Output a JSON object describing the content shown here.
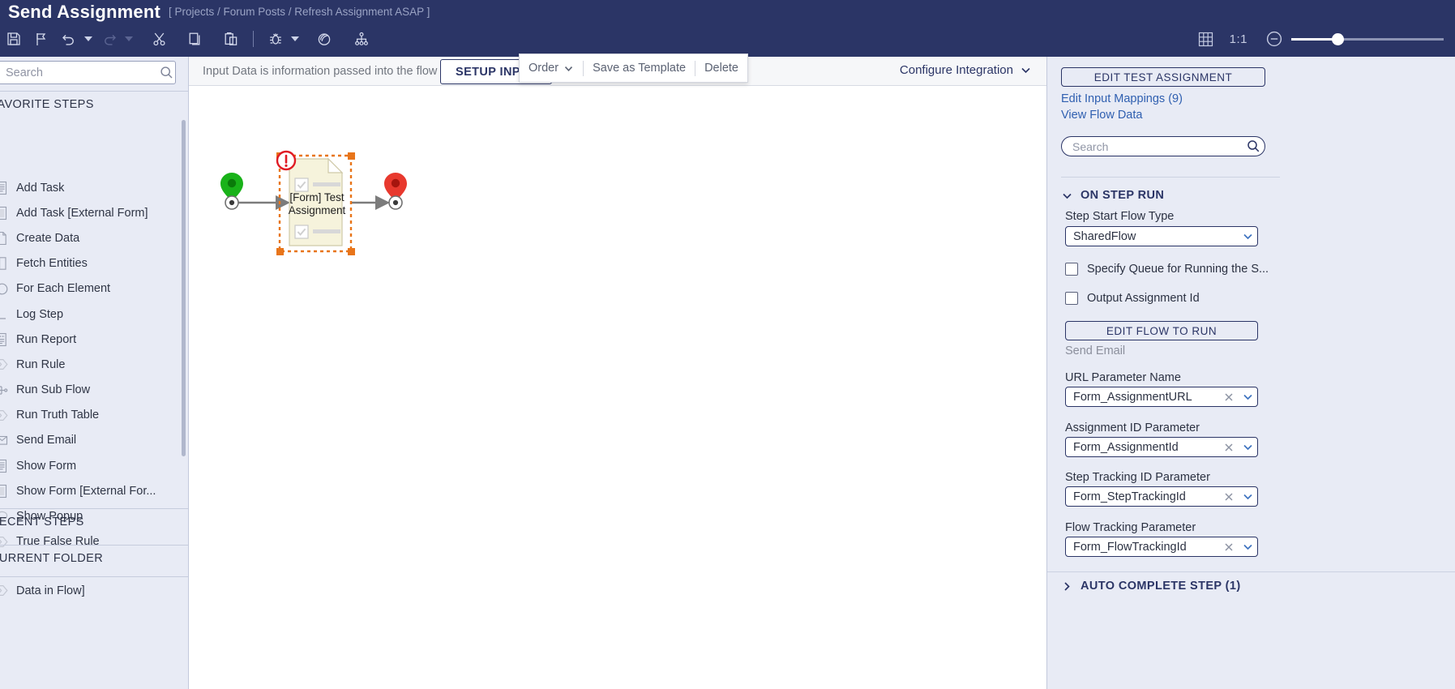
{
  "header": {
    "title": "Send Assignment",
    "breadcrumb": "[ Projects / Forum Posts / Refresh Assignment ASAP ]",
    "toolbar": [
      {
        "name": "save-icon",
        "label": "Save"
      },
      {
        "name": "flag-icon",
        "label": "Flag"
      },
      {
        "name": "undo-icon",
        "label": "Undo"
      },
      {
        "name": "redo-icon",
        "label": "Redo"
      },
      {
        "name": "cut-icon",
        "label": "Cut"
      },
      {
        "name": "copy-icon",
        "label": "Copy"
      },
      {
        "name": "paste-icon",
        "label": "Paste"
      },
      {
        "name": "debug-icon",
        "label": "Debug"
      },
      {
        "name": "target-icon",
        "label": "Simulate"
      },
      {
        "name": "hierarchy-icon",
        "label": "Layout"
      }
    ],
    "zoom": {
      "grid_icon": "grid-icon",
      "ratio_label": "1:1",
      "minus_icon": "zoom-out-icon",
      "slider_value": 27
    }
  },
  "sidebar": {
    "search": {
      "value": "",
      "placeholder": "Search",
      "icon": "search-icon"
    },
    "sections": [
      {
        "title": "FAVORITE STEPS"
      },
      {
        "title": "RECENT STEPS"
      },
      {
        "title": "CURRENT FOLDER"
      }
    ],
    "favorite_steps": [
      {
        "label": "Add Task",
        "icon": "form-lines-icon"
      },
      {
        "label": "Add Task [External Form]",
        "icon": "external-form-icon"
      },
      {
        "label": "Create Data",
        "icon": "page-icon"
      },
      {
        "label": "Fetch Entities",
        "icon": "entity-icon"
      },
      {
        "label": "For Each Element",
        "icon": "loop-icon"
      },
      {
        "label": "Log Step",
        "icon": "log-icon"
      },
      {
        "label": "Run Report",
        "icon": "report-icon"
      },
      {
        "label": "Run Rule",
        "icon": "rule-icon"
      },
      {
        "label": "Run Sub Flow",
        "icon": "subflow-icon"
      },
      {
        "label": "Run Truth Table",
        "icon": "rule-icon"
      },
      {
        "label": "Send Email",
        "icon": "envelope-icon"
      },
      {
        "label": "Show Form",
        "icon": "form-lines-icon"
      },
      {
        "label": "Show Form [External For...",
        "icon": "external-form-icon"
      },
      {
        "label": "Show Popup",
        "icon": "popup-icon"
      },
      {
        "label": "True False Rule",
        "icon": "rule-icon"
      }
    ],
    "current_folder_items": [
      {
        "label": "Data in Flow]",
        "icon": "data-icon"
      }
    ]
  },
  "canvas": {
    "note": "Input Data is information passed into the flow",
    "setup_input_label": "SETUP INPUT",
    "configure_integration_label": "Configure Integration",
    "context_menu": {
      "order_label": "Order",
      "save_as_template_label": "Save as Template",
      "delete_label": "Delete"
    },
    "nodes": [
      {
        "name": "start-node",
        "type": "start-marker",
        "color": "#17b317"
      },
      {
        "name": "form-step-node",
        "label": "[Form] Test Assignment",
        "selected": true,
        "error": true
      },
      {
        "name": "end-node",
        "type": "end-marker",
        "color": "#e8392e"
      }
    ]
  },
  "right_panel": {
    "edit_test_assignment_label": "EDIT TEST ASSIGNMENT",
    "links": [
      {
        "label": "Edit Input Mappings (9)"
      },
      {
        "label": "View Flow Data"
      }
    ],
    "search": {
      "value": "",
      "placeholder": "Search",
      "icon": "search-icon"
    },
    "sections": [
      {
        "title": "ON STEP RUN",
        "expanded": true,
        "fields": {
          "step_start_flow_type_label": "Step Start Flow Type",
          "step_start_flow_type_value": "SharedFlow",
          "specify_queue_label": "Specify Queue for Running the S...",
          "specify_queue_checked": false,
          "output_assignment_id_label": "Output Assignment Id",
          "output_assignment_id_checked": false,
          "edit_flow_to_run_label": "EDIT FLOW TO RUN",
          "edit_flow_to_run_sub": "Send Email",
          "url_parameter_name_label": "URL Parameter Name",
          "url_parameter_name_value": "Form_AssignmentURL",
          "assignment_id_parameter_label": "Assignment ID Parameter",
          "assignment_id_parameter_value": "Form_AssignmentId",
          "step_tracking_id_parameter_label": "Step Tracking ID Parameter",
          "step_tracking_id_parameter_value": "Form_StepTrackingId",
          "flow_tracking_parameter_label": "Flow Tracking Parameter",
          "flow_tracking_parameter_value": "Form_FlowTrackingId"
        }
      },
      {
        "title": "AUTO COMPLETE STEP (1)",
        "expanded": false
      }
    ]
  },
  "colors": {
    "header_bg": "#2b3566",
    "panel_bg": "#e8ebf5",
    "accent": "#2b3566",
    "link": "#2f5fb0",
    "start_marker": "#17b317",
    "end_marker": "#e8392e",
    "selection": "#e8751a",
    "error": "#e01b24"
  }
}
